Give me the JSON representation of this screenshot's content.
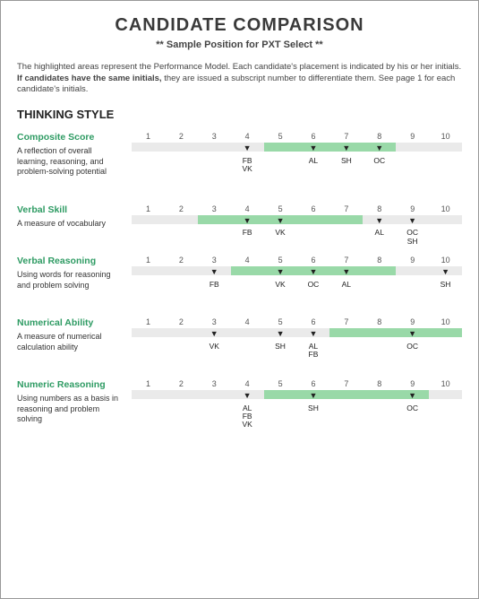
{
  "title": "CANDIDATE COMPARISON",
  "subtitle": "** Sample Position for PXT Select **",
  "intro_a": "The highlighted areas represent the Performance Model. Each candidate's placement is indicated by his or her initials. ",
  "intro_b": "If candidates have the same initials,",
  "intro_c": " they are issued a subscript number to differentiate them. See page 1 for each candidate's initials.",
  "section": "THINKING STYLE",
  "ticks": [
    "1",
    "2",
    "3",
    "4",
    "5",
    "6",
    "7",
    "8",
    "9",
    "10"
  ],
  "rows": [
    {
      "name": "Composite Score",
      "desc": "A reflection of overall learning, reasoning, and problem-solving potential",
      "hl_start": 5,
      "hl_end": 8,
      "markers": [
        {
          "pos": 4,
          "labels": [
            "FB",
            "VK"
          ]
        },
        {
          "pos": 6,
          "labels": [
            "AL"
          ]
        },
        {
          "pos": 7,
          "labels": [
            "SH"
          ]
        },
        {
          "pos": 8,
          "labels": [
            "OC"
          ]
        }
      ]
    },
    {
      "name": "Verbal Skill",
      "desc": "A measure of vocabulary",
      "hl_start": 3,
      "hl_end": 7,
      "markers": [
        {
          "pos": 4,
          "labels": [
            "FB"
          ]
        },
        {
          "pos": 5,
          "labels": [
            "VK"
          ]
        },
        {
          "pos": 8,
          "labels": [
            "AL"
          ]
        },
        {
          "pos": 9,
          "labels": [
            "OC",
            "SH"
          ]
        }
      ]
    },
    {
      "name": "Verbal Reasoning",
      "desc": "Using words for reasoning and problem solving",
      "hl_start": 4,
      "hl_end": 8,
      "markers": [
        {
          "pos": 3,
          "labels": [
            "FB"
          ]
        },
        {
          "pos": 5,
          "labels": [
            "VK"
          ]
        },
        {
          "pos": 6,
          "labels": [
            "OC"
          ]
        },
        {
          "pos": 7,
          "labels": [
            "AL"
          ]
        },
        {
          "pos": 10,
          "labels": [
            "SH"
          ]
        }
      ]
    },
    {
      "name": "Numerical Ability",
      "desc": "A measure of numerical calculation ability",
      "hl_start": 7,
      "hl_end": 10,
      "markers": [
        {
          "pos": 3,
          "labels": [
            "VK"
          ]
        },
        {
          "pos": 5,
          "labels": [
            "SH"
          ]
        },
        {
          "pos": 6,
          "labels": [
            "AL",
            "FB"
          ]
        },
        {
          "pos": 9,
          "labels": [
            "OC"
          ]
        }
      ]
    },
    {
      "name": "Numeric Reasoning",
      "desc": "Using numbers as a basis in reasoning and problem solving",
      "hl_start": 5,
      "hl_end": 9,
      "markers": [
        {
          "pos": 4,
          "labels": [
            "AL",
            "FB",
            "VK"
          ]
        },
        {
          "pos": 6,
          "labels": [
            "SH"
          ]
        },
        {
          "pos": 9,
          "labels": [
            "OC"
          ]
        }
      ]
    }
  ]
}
